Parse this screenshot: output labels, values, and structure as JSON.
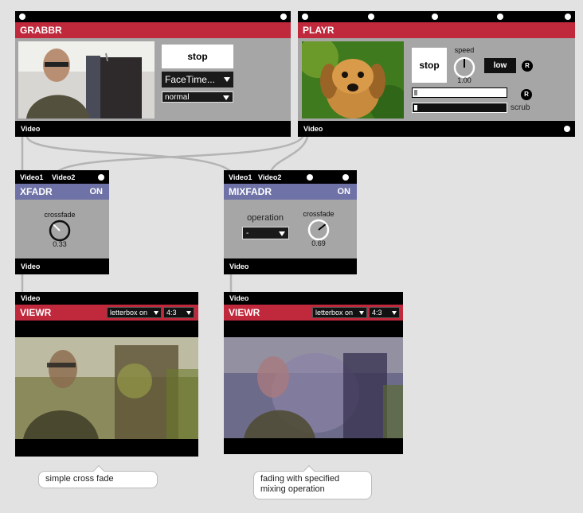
{
  "grabbr": {
    "title": "GRABBR",
    "start_stop_label": "stop",
    "device_menu": "FaceTime...",
    "quality_menu": "normal",
    "outlet_label": "Video"
  },
  "playr": {
    "title": "PLAYR",
    "stop_label": "stop",
    "speed_label": "speed",
    "speed_value": "1.00",
    "speed_knob_fraction": 0.5,
    "low_label": "low",
    "reset_label": "R",
    "reset2_label": "R",
    "scrub_label": "scrub",
    "position_fraction": 0.02,
    "scrub_fraction": 0.02,
    "outlet_label": "Video"
  },
  "xfadr": {
    "title": "XFADR",
    "status": "ON",
    "inlet1_label": "Video1",
    "inlet2_label": "Video2",
    "crossfade_label": "crossfade",
    "crossfade_value": "0.33",
    "outlet_label": "Video"
  },
  "mixfadr": {
    "title": "MIXFADR",
    "status": "ON",
    "inlet1_label": "Video1",
    "inlet2_label": "Video2",
    "operation_label": "operation",
    "operation_menu": "-",
    "crossfade_label": "crossfade",
    "crossfade_value": "0.69",
    "outlet_label": "Video"
  },
  "viewr_left": {
    "inlet_label": "Video",
    "title": "VIEWR",
    "letterbox_menu": "letterbox on",
    "aspect_menu": "4:3"
  },
  "viewr_right": {
    "inlet_label": "Video",
    "title": "VIEWR",
    "letterbox_menu": "letterbox on",
    "aspect_menu": "4:3"
  },
  "comments": {
    "left": "simple cross fade",
    "right_line1": "fading with specified",
    "right_line2": "mixing operation"
  },
  "colors": {
    "title_red": "#c0283c",
    "title_blue": "#6e72a6",
    "module_gray": "#a6a6a6",
    "canvas": "#e2e2e2"
  }
}
